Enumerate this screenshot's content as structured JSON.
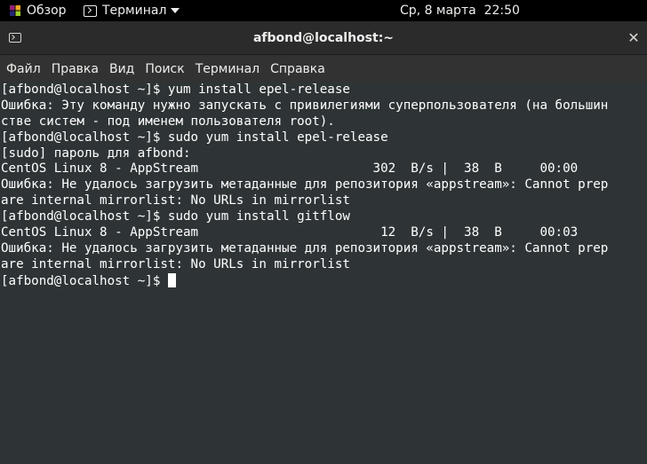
{
  "topbar": {
    "activities_label": "Обзор",
    "app_label": "Терминал",
    "clock": "Ср, 8 марта  22:50"
  },
  "window": {
    "title": "afbond@localhost:~",
    "close_glyph": "✕"
  },
  "menubar": {
    "items": [
      "Файл",
      "Правка",
      "Вид",
      "Поиск",
      "Терминал",
      "Справка"
    ]
  },
  "terminal": {
    "lines": [
      "[afbond@localhost ~]$ yum install epel-release",
      "Ошибка: Эту команду нужно запускать с привилегиями суперпользователя (на большин",
      "стве систем - под именем пользователя root).",
      "[afbond@localhost ~]$ sudo yum install epel-release",
      "[sudo] пароль для afbond:",
      "CentOS Linux 8 - AppStream                       302  B/s |  38  B     00:00",
      "Ошибка: Не удалось загрузить метаданные для репозитория «appstream»: Cannot prep",
      "are internal mirrorlist: No URLs in mirrorlist",
      "[afbond@localhost ~]$ sudo yum install gitflow",
      "CentOS Linux 8 - AppStream                        12  B/s |  38  B     00:03",
      "Ошибка: Не удалось загрузить метаданные для репозитория «appstream»: Cannot prep",
      "are internal mirrorlist: No URLs in mirrorlist"
    ],
    "prompt": "[afbond@localhost ~]$ "
  }
}
